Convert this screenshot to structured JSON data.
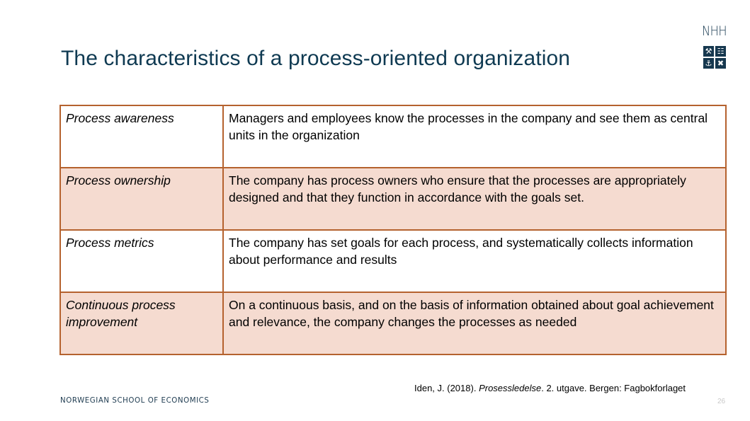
{
  "slide": {
    "title": "The characteristics of a process-oriented organization",
    "logo": {
      "text": "NHH",
      "icons": [
        "tools-icon",
        "ledger-icon",
        "anchor-icon",
        "ship-icon"
      ]
    },
    "table": {
      "rows": [
        {
          "term": "Process awareness",
          "description": "Managers and employees know the processes in the company and see them as central units in the organization"
        },
        {
          "term": "Process ownership",
          "description": "The company has process owners who ensure that the processes are appropriately designed and that they function in accordance with the goals set."
        },
        {
          "term": "Process metrics",
          "description": "The company has set goals for each process, and systematically collects information about performance and results"
        },
        {
          "term": "Continuous process improvement",
          "description": "On a continuous basis, and on the basis of information obtained about goal achievement and relevance, the company changes the processes as needed"
        }
      ]
    },
    "citation": {
      "prefix": "Iden, J. (2018). ",
      "book_title": "Prosessledelse",
      "suffix": ". 2. utgave. Bergen: Fagbokforlaget"
    },
    "footer": {
      "school": "NORWEGIAN SCHOOL OF ECONOMICS",
      "page_number": "26"
    },
    "colors": {
      "title": "#0f3a52",
      "table_border": "#b5622e",
      "row_shade": "#f5dbd0",
      "logo": "#16384f"
    }
  }
}
